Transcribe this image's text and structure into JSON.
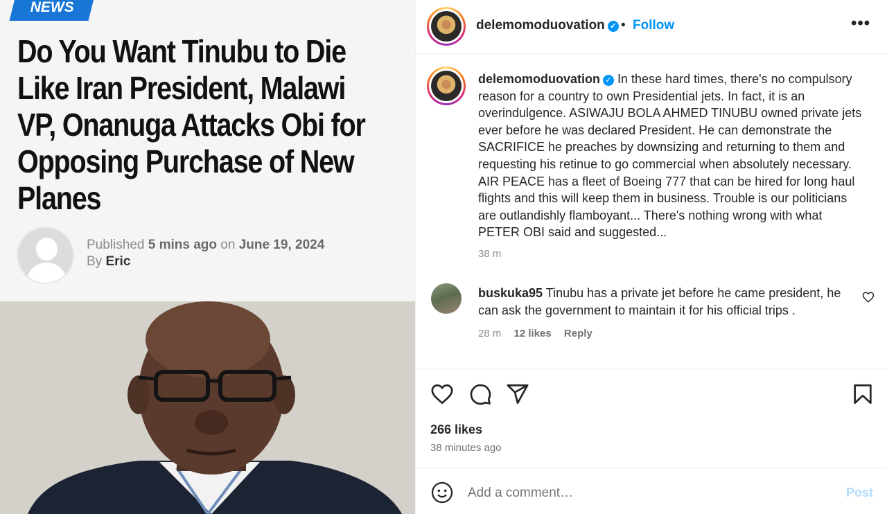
{
  "article": {
    "badge": "NEWS",
    "headline_lines": [
      "Do You Want Tinubu to Die",
      "Like Iran President, Malawi",
      "VP, Onanuga Attacks Obi for",
      "Opposing Purchase of New",
      "Planes"
    ],
    "published_prefix": "Published",
    "published_time": "5 mins ago",
    "published_on": "on",
    "published_date": "June 19, 2024",
    "by_prefix": "By",
    "author": "Eric"
  },
  "post": {
    "username": "delemomoduovation",
    "verified_icon": "verified-badge-icon",
    "separator": "•",
    "follow_label": "Follow",
    "more_label": "•••",
    "caption": "In these hard times, there's no compulsory reason for a country to own Presidential jets. In fact, it is an overindulgence. ASIWAJU BOLA AHMED TINUBU owned private jets ever before he was declared President. He can demonstrate the SACRIFICE he preaches by downsizing and returning to them and requesting his retinue to go commercial when absolutely necessary. AIR PEACE has a fleet of Boeing 777 that can be hired for long haul flights and this will keep them in business. Trouble is our politicians are outlandishly flamboyant... There's nothing wrong with what PETER OBI said and suggested...",
    "caption_time": "38 m",
    "comments": [
      {
        "username": "buskuka95",
        "text": "Tinubu has a private jet before he came president, he can ask the government to maintain it for his official trips .",
        "time": "28 m",
        "likes": "12 likes",
        "reply_label": "Reply"
      }
    ],
    "likes": "266 likes",
    "posted_ago": "38 minutes ago",
    "add_comment_placeholder": "Add a comment…",
    "post_label": "Post",
    "colors": {
      "link": "#0095f6",
      "post_disabled": "#b3dbff"
    },
    "icons": [
      "heart-icon",
      "comment-icon",
      "share-icon",
      "bookmark-icon",
      "emoji-icon"
    ]
  }
}
